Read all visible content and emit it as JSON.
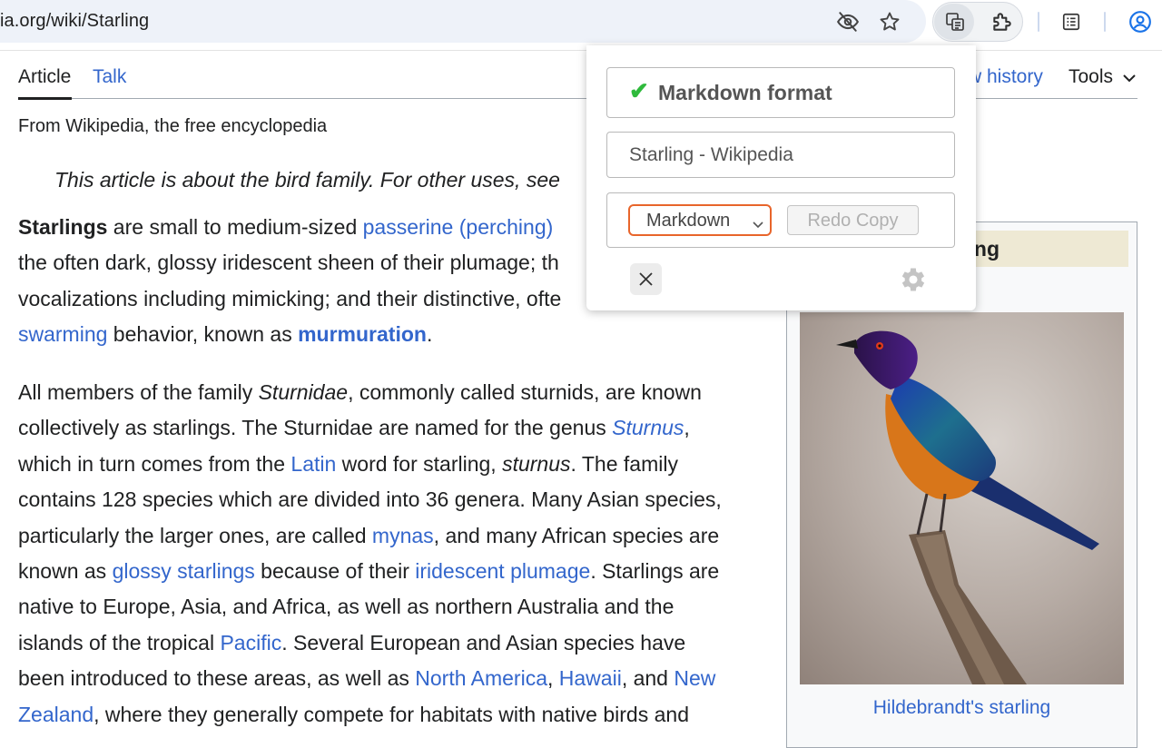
{
  "browser": {
    "url": "ia.org/wiki/Starling"
  },
  "wiki": {
    "tabs": {
      "article": "Article",
      "talk": "Talk",
      "history": "w history",
      "tools": "Tools"
    },
    "from": "From Wikipedia, the free encyclopedia",
    "hatnote": "This article is about the bird family. For other uses, see",
    "p1": {
      "l1_a": "Starlings",
      "l1_b": " are small to medium-sized ",
      "l1_c": "passerine (perching)",
      "l2": "the often dark, glossy iridescent sheen of their plumage; th",
      "l3": "vocalizations including mimicking; and their distinctive, ofte",
      "l4_a": "swarming",
      "l4_b": " behavior, known as ",
      "l4_c": "murmuration",
      "l4_d": "."
    },
    "p2": {
      "l1_a": "All members of the family ",
      "l1_b": "Sturnidae",
      "l1_c": ", commonly called sturnids, are known",
      "l2_a": "collectively as starlings. The Sturnidae are named for the genus ",
      "l2_b": "Sturnus",
      "l2_c": ",",
      "l3_a": "which in turn comes from the ",
      "l3_b": "Latin",
      "l3_c": " word for starling, ",
      "l3_d": "sturnus",
      "l3_e": ". The family",
      "l4": "contains 128 species which are divided into 36 genera. Many Asian species,",
      "l5_a": "particularly the larger ones, are called ",
      "l5_b": "mynas",
      "l5_c": ", and many African species are",
      "l6_a": "known as ",
      "l6_b": "glossy starlings",
      "l6_c": " because of their ",
      "l6_d": "iridescent plumage",
      "l6_e": ". Starlings are",
      "l7": "native to Europe, Asia, and Africa, as well as northern Australia and the",
      "l8_a": "islands of the tropical ",
      "l8_b": "Pacific",
      "l8_c": ". Several European and Asian species have",
      "l9_a": "been introduced to these areas, as well as ",
      "l9_b": "North America",
      "l9_c": ", ",
      "l9_d": "Hawaii",
      "l9_e": ", and ",
      "l9_f": "New",
      "l10_a": "Zealand",
      "l10_b": ", where they generally compete for habitats with native birds and"
    },
    "infobox": {
      "title": "ng",
      "caption": "Hildebrandt's starling"
    }
  },
  "popup": {
    "status": "Markdown format",
    "page_title": "Starling - Wikipedia",
    "format_selected": "Markdown",
    "redo_label": "Redo Copy"
  },
  "colors": {
    "link": "#3366cc",
    "accent_orange": "#e8652b",
    "check_green": "#2fba3c"
  },
  "icons": [
    "eye-off-icon",
    "star-icon",
    "copy-extension-icon",
    "puzzle-icon",
    "reading-list-icon",
    "profile-icon",
    "chevron-down-icon",
    "checkmark-icon",
    "close-icon",
    "gear-icon"
  ]
}
